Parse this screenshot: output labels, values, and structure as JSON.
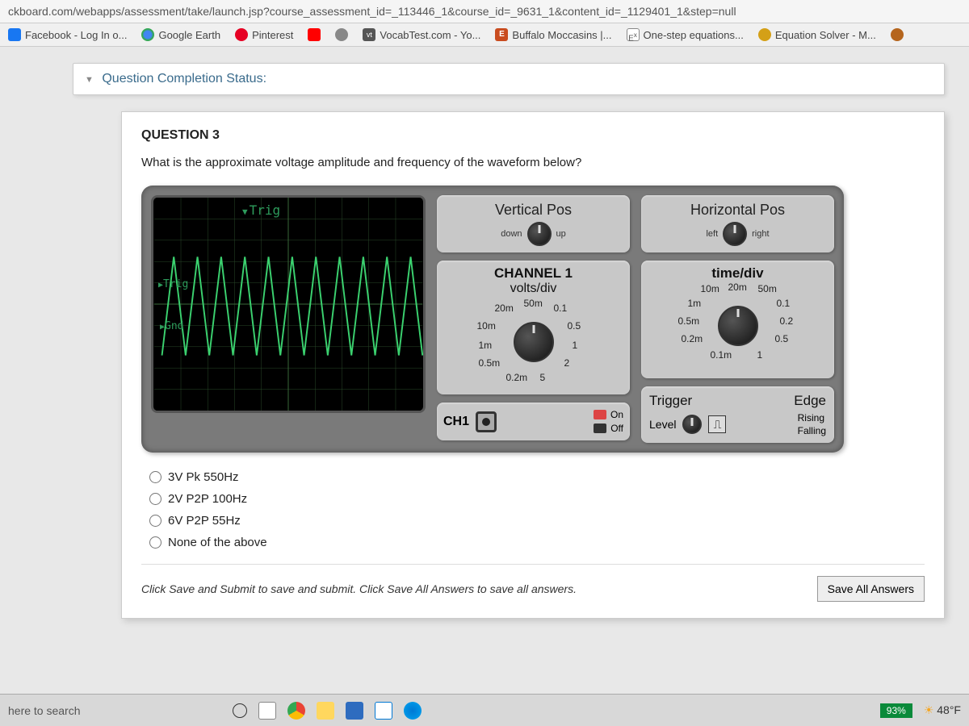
{
  "url": "ckboard.com/webapps/assessment/take/launch.jsp?course_assessment_id=_113446_1&course_id=_9631_1&content_id=_1129401_1&step=null",
  "bookmarks": {
    "fb": "Facebook - Log In o...",
    "ge": "Google Earth",
    "pin": "Pinterest",
    "vt": "VocabTest.com - Yo...",
    "buf": "Buffalo Moccasins |...",
    "ose": "One-step equations...",
    "eq": "Equation Solver - M..."
  },
  "status": "Question Completion Status:",
  "question": {
    "number": "QUESTION 3",
    "text": "What is the approximate voltage amplitude and frequency of the waveform below?"
  },
  "scope": {
    "screen": {
      "trig": "Trig",
      "trig2": "Trig",
      "gnd": "Gnd"
    },
    "vpos": {
      "title": "Vertical Pos",
      "left": "down",
      "right": "up"
    },
    "hpos": {
      "title": "Horizontal Pos",
      "left": "left",
      "right": "right"
    },
    "ch1dial": {
      "t1": "CHANNEL 1",
      "t2": "volts/div",
      "ticks": [
        "50m",
        "0.1",
        "0.5",
        "1",
        "2",
        "5",
        "0.2m",
        "0.5m",
        "1m",
        "10m",
        "20m"
      ]
    },
    "timedial": {
      "t1": "time/div",
      "ticks": [
        "20m",
        "50m",
        "0.1",
        "0.2",
        "0.5",
        "1",
        "0.1m",
        "0.2m",
        "0.5m",
        "1m",
        "10m"
      ]
    },
    "chpanel": {
      "label": "CH1",
      "on": "On",
      "off": "Off"
    },
    "trig": {
      "t": "Trigger",
      "e": "Edge",
      "level": "Level",
      "rising": "Rising",
      "falling": "Falling"
    }
  },
  "answers": {
    "a": "3V Pk 550Hz",
    "b": "2V P2P 100Hz",
    "c": "6V P2P 55Hz",
    "d": "None of the above"
  },
  "footer": "Click Save and Submit to save and submit. Click Save All Answers to save all answers.",
  "save_btn": "Save All Answers",
  "taskbar": {
    "search": "here to search",
    "battery": "93%",
    "temp": "48°F"
  }
}
